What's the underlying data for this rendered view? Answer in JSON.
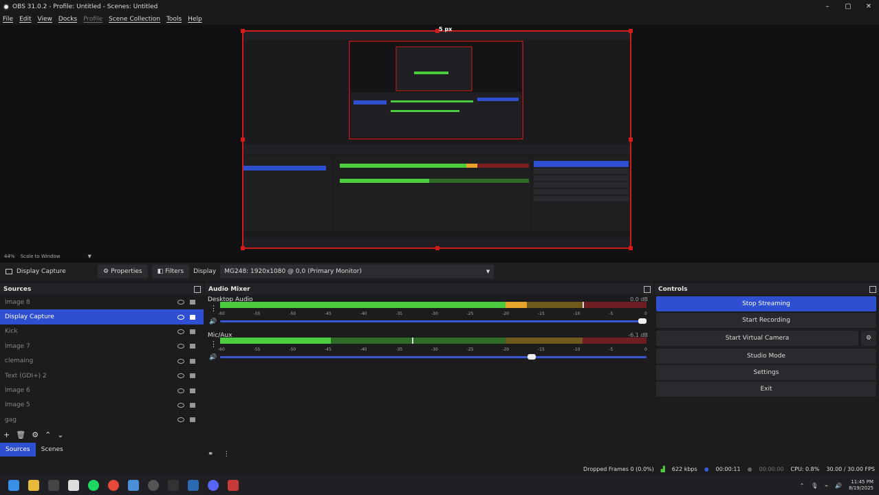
{
  "window": {
    "title": "OBS 31.0.2 - Profile: Untitled - Scenes: Untitled",
    "minimize": "–",
    "maximize": "▢",
    "close": "✕"
  },
  "menu": [
    "File",
    "Edit",
    "View",
    "Docks",
    "Profile",
    "Scene Collection",
    "Tools",
    "Help"
  ],
  "preview": {
    "dim_label": "5 px",
    "zoom": "44%",
    "scale_mode": "Scale to Window"
  },
  "source_toolbar": {
    "source_name": "Display Capture",
    "properties": "Properties",
    "filters": "Filters",
    "display_label": "Display",
    "display_value": "MG248: 1920x1080 @ 0,0 (Primary Monitor)"
  },
  "sources": {
    "title": "Sources",
    "items": [
      "Image 8",
      "Display Capture",
      "Kick",
      "Image 7",
      "clemaing",
      "Text (GDI+) 2",
      "Image 6",
      "Image 5",
      "gag"
    ],
    "active_index": 1,
    "tab_sources": "Sources",
    "tab_scenes": "Scenes"
  },
  "mixer": {
    "title": "Audio Mixer",
    "channels": [
      {
        "name": "Desktop Audio",
        "db": "0.0 dB",
        "level": 0.72,
        "peak": 0.85,
        "volume": 1.0
      },
      {
        "name": "Mic/Aux",
        "db": "-6.1 dB",
        "level": 0.26,
        "peak": 0.45,
        "volume": 0.74
      }
    ],
    "scale": [
      "-60",
      "-55",
      "-50",
      "-45",
      "-40",
      "-35",
      "-30",
      "-25",
      "-20",
      "-15",
      "-10",
      "-5",
      "0"
    ]
  },
  "controls": {
    "title": "Controls",
    "buttons": [
      "Stop Streaming",
      "Start Recording",
      "Start Virtual Camera",
      "Studio Mode",
      "Settings",
      "Exit"
    ]
  },
  "status": {
    "dropped": "Dropped Frames 0 (0.0%)",
    "bitrate": "622 kbps",
    "stream_time": "00:00:11",
    "rec_time": "00:00:00",
    "cpu": "CPU: 0.8%",
    "fps": "30.00 / 30.00 FPS"
  },
  "clock": {
    "time": "11:45 PM",
    "date": "8/19/2025"
  },
  "colors": {
    "accent": "#2f4fd1",
    "green": "#4ccd3f",
    "yellow": "#e6a52a",
    "red": "#c8262a",
    "border": "#d21c1c"
  }
}
